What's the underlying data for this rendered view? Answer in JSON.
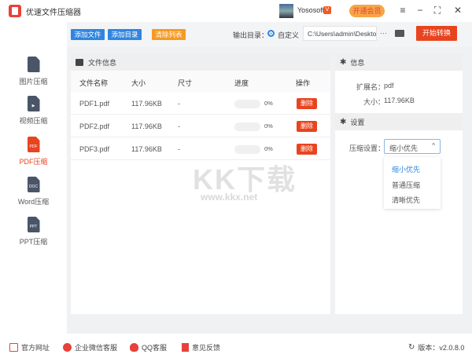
{
  "app": {
    "title": "优速文件压缩器",
    "username": "Yososoft",
    "vip_label": "开通会员",
    "vbadge": "V"
  },
  "toolbar": {
    "add_file": "添加文件",
    "add_folder": "添加目录",
    "clear_list": "清除列表",
    "output_label": "输出目录：",
    "output_option": "自定义",
    "output_path": "C:\\Users\\admin\\Deskto",
    "more": "···",
    "start": "开始转换"
  },
  "sidebar": {
    "items": [
      {
        "label": "图片压缩",
        "tag": ""
      },
      {
        "label": "视频压缩",
        "tag": ""
      },
      {
        "label": "PDF压缩",
        "tag": "PDF"
      },
      {
        "label": "Word压缩",
        "tag": "DOC"
      },
      {
        "label": "PPT压缩",
        "tag": "PPT"
      }
    ]
  },
  "files": {
    "title": "文件信息",
    "headers": [
      "文件名称",
      "大小",
      "尺寸",
      "进度",
      "操作"
    ],
    "rows": [
      {
        "name": "PDF1.pdf",
        "size": "117.96KB",
        "dim": "-",
        "progress": "0%",
        "action": "删除"
      },
      {
        "name": "PDF2.pdf",
        "size": "117.96KB",
        "dim": "-",
        "progress": "0%",
        "action": "删除"
      },
      {
        "name": "PDF3.pdf",
        "size": "117.96KB",
        "dim": "-",
        "progress": "0%",
        "action": "删除"
      }
    ]
  },
  "info": {
    "title": "信息",
    "ext_label": "扩展名：",
    "ext": "pdf",
    "size_label": "大小：",
    "size": "117.96KB"
  },
  "settings": {
    "title": "设置",
    "label": "压缩设置：",
    "selected": "缩小优先",
    "options": [
      "缩小优先",
      "普通压缩",
      "清晰优先"
    ]
  },
  "footer": {
    "website": "官方网址",
    "wechat": "企业微信客服",
    "qq": "QQ客服",
    "feedback": "意见反馈",
    "version": "版本：v2.0.8.0"
  },
  "watermark": {
    "main": "KK下载",
    "url": "www.kkx.net"
  },
  "colors": {
    "accent": "#2f86e0",
    "danger": "#e8441f",
    "orange": "#f59a23"
  }
}
